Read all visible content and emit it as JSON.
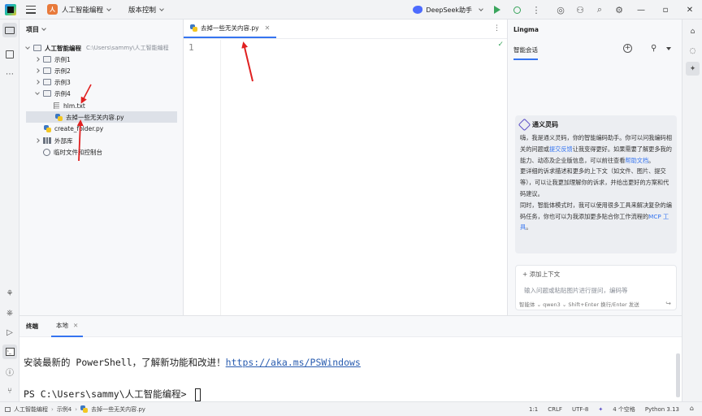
{
  "titlebar": {
    "project_badge": "人",
    "project_name": "人工智能编程",
    "vcs_label": "版本控制",
    "ai_assistant": "DeepSeek助手"
  },
  "project_panel": {
    "title": "项目",
    "root": {
      "name": "人工智能编程",
      "path": "C:\\Users\\sammy\\人工智能编程"
    },
    "items": [
      {
        "label": "示例1",
        "type": "folder"
      },
      {
        "label": "示例2",
        "type": "folder"
      },
      {
        "label": "示例3",
        "type": "folder"
      },
      {
        "label": "示例4",
        "type": "folder"
      },
      {
        "label": "hlm.txt",
        "type": "txt"
      },
      {
        "label": "去掉一些无关内容.py",
        "type": "py"
      },
      {
        "label": "create_folder.py",
        "type": "py"
      },
      {
        "label": "外部库",
        "type": "lib"
      },
      {
        "label": "临时文件和控制台",
        "type": "scratch"
      }
    ]
  },
  "editor": {
    "tab_label": "去掉一些无关内容.py",
    "line_number": "1"
  },
  "ai_panel": {
    "title": "Lingma",
    "tab": "智能会话",
    "card_title": "通义灵码",
    "p1_a": "嗨，我是通义灵码，你的智能编码助手。你可以问我编码相关的问题或",
    "p1_link1": "提交反馈",
    "p1_b": "让我变得更好。如果需要了解更多我的能力、动态及企业版信息，可以前往查看",
    "p1_link2": "帮助文档",
    "p1_c": "。",
    "p2": "更详细的诉求描述和更多的上下文（如文件、图片、提交等），可以让我更加理解你的诉求，并给出更好的方案和代码建议。",
    "p3_a": "同时，智能体模式时，我可以使用很多工具来解决复杂的编码任务，你也可以为我添加更多贴合你工作流程的",
    "p3_link": "MCP 工具",
    "p3_b": "。",
    "add_context": "添加上下文",
    "input_placeholder": "输入问题或粘贴图片进行提问，编码等",
    "input_footer": "智能体 ⌄   qwen3 ⌄  Shift+Enter 换行/Enter 发送"
  },
  "terminal": {
    "title": "终端",
    "tab": "本地",
    "line1_text": "安装最新的 PowerShell，了解新功能和改进！",
    "line1_link": "https://aka.ms/PSWindows",
    "line2": "PS C:\\Users\\sammy\\人工智能编程> "
  },
  "statusbar": {
    "crumbs": [
      "人工智能编程",
      "示例4",
      "去掉一些无关内容.py"
    ],
    "position": "1:1",
    "line_sep": "CRLF",
    "encoding": "UTF-8",
    "indent": "4 个空格",
    "interpreter": "Python 3.13"
  },
  "colors": {
    "accent": "#3574f0",
    "annotation": "#e02020"
  }
}
